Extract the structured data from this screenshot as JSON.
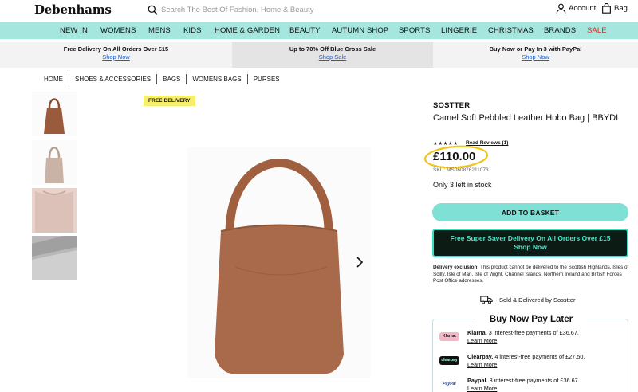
{
  "header": {
    "logo": "Debenhams",
    "search_placeholder": "Search The Best Of Fashion, Home & Beauty",
    "account_label": "Account",
    "bag_label": "Bag"
  },
  "nav": {
    "items": [
      "NEW IN",
      "WOMENS",
      "MENS",
      "KIDS",
      "HOME & GARDEN",
      "BEAUTY",
      "AUTUMN SHOP",
      "SPORTS",
      "LINGERIE",
      "CHRISTMAS",
      "BRANDS",
      "SALE"
    ]
  },
  "promos": [
    {
      "title": "Free Delivery On All Orders Over £15",
      "link": "Shop Now"
    },
    {
      "title": "Up to 70% Off Blue Cross Sale",
      "link": "Shop Sale"
    },
    {
      "title": "Buy Now or Pay In 3 with PayPal",
      "link": "Shop Now"
    }
  ],
  "breadcrumb": [
    "HOME",
    "SHOES & ACCESSORIES",
    "BAGS",
    "WOMENS BAGS",
    "PURSES"
  ],
  "gallery": {
    "badge": "FREE DELIVERY",
    "thumbnail_colors": [
      "#9a5a3c",
      "#c9b3a6",
      "#dcc1b9",
      "#b8b8b8"
    ],
    "main_color": "#a86a4a"
  },
  "product": {
    "brand": "SOSTTER",
    "title": "Camel Soft Pebbled Leather Hobo Bag | BBYDI",
    "rating_stars": "★★★★★",
    "reviews_link": "Read Reviews (1)",
    "price": "£110.00",
    "sku": "SKU: MS060876211073",
    "stock": "Only 3 left in stock",
    "add_to_basket": "ADD TO BASKET",
    "saver_line1": "Free Super Saver Delivery On All Orders Over £15",
    "saver_line2": "Shop Now",
    "exclusion_label": "Delivery exclusion:",
    "exclusion_text": " This product cannot be delivered to the Scottish Highlands, Isles of Scilly, Isle of Man, Isle of Wight, Channel Islands, Northern Ireland and British Forces Post Office addresses.",
    "sold_by": "Sold & Delivered by Sosstter"
  },
  "bnpl": {
    "title": "Buy Now Pay Later",
    "options": [
      {
        "logo": "Klarna.",
        "name": "Klarna.",
        "text": " 3 interest-free payments of £36.67.",
        "link": "Learn More",
        "logo_bg": "#f4b6c7",
        "logo_fg": "#111"
      },
      {
        "logo": "clearpay",
        "name": "Clearpay.",
        "text": " 4 interest-free payments of £27.50.",
        "link": "Learn More",
        "logo_bg": "#111111",
        "logo_fg": "#b2fce4"
      },
      {
        "logo": "PayPal",
        "name": "Paypal.",
        "text": " 3 interest-free payments of £36.67.",
        "link": "Learn More",
        "logo_bg": "#ffffff",
        "logo_fg": "#1f3c88"
      }
    ]
  },
  "colors": {
    "nav_bg": "#a5e6df",
    "basket_bg": "#7fe0d5",
    "sale": "#d93025",
    "highlight_ring": "#f0c419"
  }
}
